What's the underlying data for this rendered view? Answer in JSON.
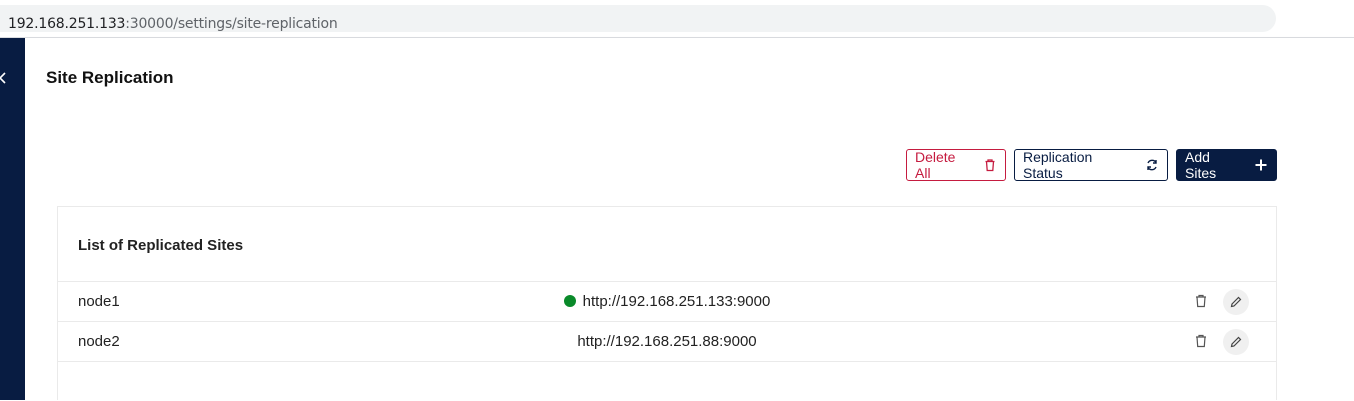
{
  "browser": {
    "url_host": "192.168.251.133",
    "url_path": ":30000/settings/site-replication"
  },
  "header": {
    "title": "Site Replication"
  },
  "toolbar": {
    "delete_all_label": "Delete All",
    "replication_status_label": "Replication Status",
    "add_sites_label": "Add Sites"
  },
  "panel": {
    "title": "List of Replicated Sites",
    "rows": [
      {
        "name": "node1",
        "endpoint": "http://192.168.251.133:9000",
        "status": "online"
      },
      {
        "name": "node2",
        "endpoint": "http://192.168.251.88:9000",
        "status": ""
      }
    ]
  },
  "colors": {
    "brand": "#081c42",
    "danger": "#c51b3f",
    "online": "#0a8a2a"
  },
  "icons": {
    "delete_all": "trash-icon",
    "replication_status": "refresh-icon",
    "add_sites": "plus-icon",
    "row_delete": "trash-icon",
    "row_edit": "pencil-icon",
    "sidebar": "chevron-left-icon"
  }
}
